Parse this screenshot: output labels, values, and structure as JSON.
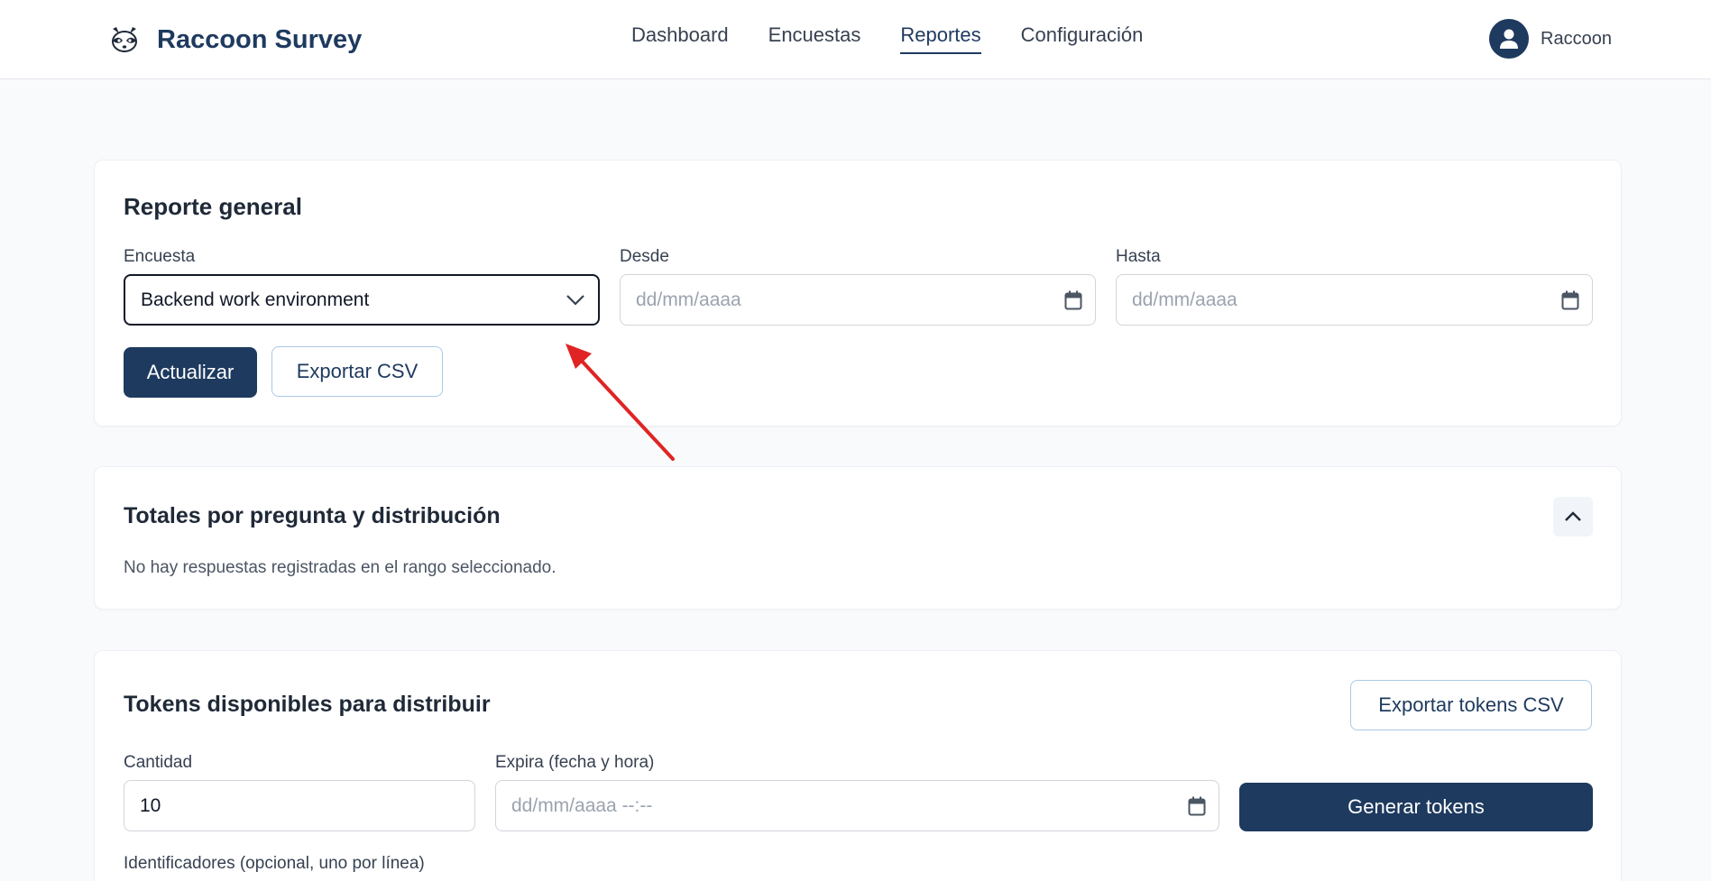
{
  "app": {
    "name": "Raccoon Survey",
    "logo_icon": "raccoon-icon"
  },
  "nav": {
    "items": [
      {
        "label": "Dashboard",
        "active": false
      },
      {
        "label": "Encuestas",
        "active": false
      },
      {
        "label": "Reportes",
        "active": true
      },
      {
        "label": "Configuración",
        "active": false
      }
    ]
  },
  "user": {
    "name": "Raccoon",
    "icon": "user-icon"
  },
  "report": {
    "title": "Reporte general",
    "survey_label": "Encuesta",
    "survey_value": "Backend work environment",
    "from_label": "Desde",
    "from_placeholder": "dd/mm/aaaa",
    "to_label": "Hasta",
    "to_placeholder": "dd/mm/aaaa",
    "update_button": "Actualizar",
    "export_button": "Exportar CSV"
  },
  "totals": {
    "title": "Totales por pregunta y distribución",
    "empty_message": "No hay respuestas registradas en el rango seleccionado."
  },
  "tokens": {
    "title": "Tokens disponibles para distribuir",
    "export_button": "Exportar tokens CSV",
    "quantity_label": "Cantidad",
    "quantity_value": "10",
    "expires_label": "Expira (fecha y hora)",
    "expires_placeholder": "dd/mm/aaaa --:--",
    "generate_button": "Generar tokens",
    "identifiers_label": "Identificadores (opcional, uno por línea)"
  },
  "colors": {
    "primary": "#1e3a5f",
    "annotation_arrow": "#e02424"
  }
}
